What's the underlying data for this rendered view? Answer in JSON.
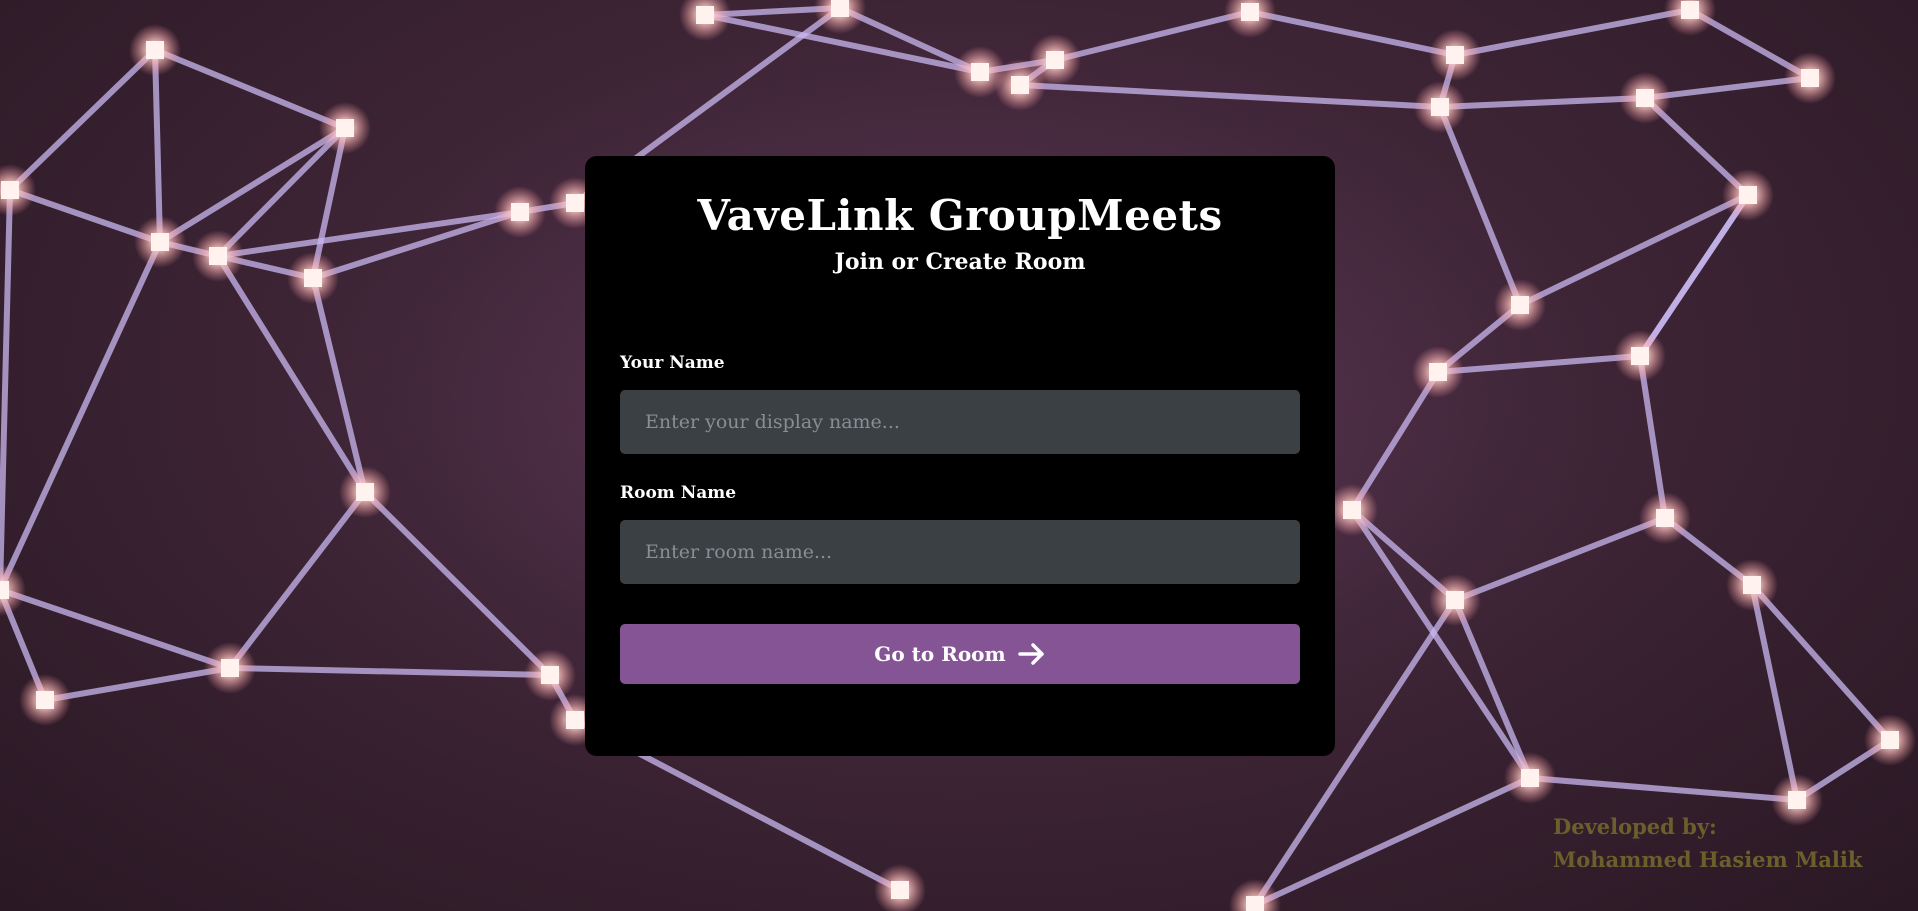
{
  "app": {
    "title": "VaveLink GroupMeets",
    "subtitle": "Join or Create Room"
  },
  "form": {
    "name_label": "Your Name",
    "name_placeholder": "Enter your display name...",
    "name_value": "",
    "room_label": "Room Name",
    "room_placeholder": "Enter room name...",
    "room_value": "",
    "submit_label": "Go to Room",
    "submit_icon": "arrow-right-icon"
  },
  "footer": {
    "line1": "Developed by:",
    "line2": "Mohammed Hasiem Malik"
  },
  "colors": {
    "card_background": "#000000",
    "input_background": "#3b4045",
    "button_accent": "#845494",
    "credit_text": "#6b5f2c",
    "network_lines": "#c9b8f0",
    "network_nodes": "#ffd6d2"
  },
  "background": {
    "description_icon": "network-mesh-background"
  }
}
